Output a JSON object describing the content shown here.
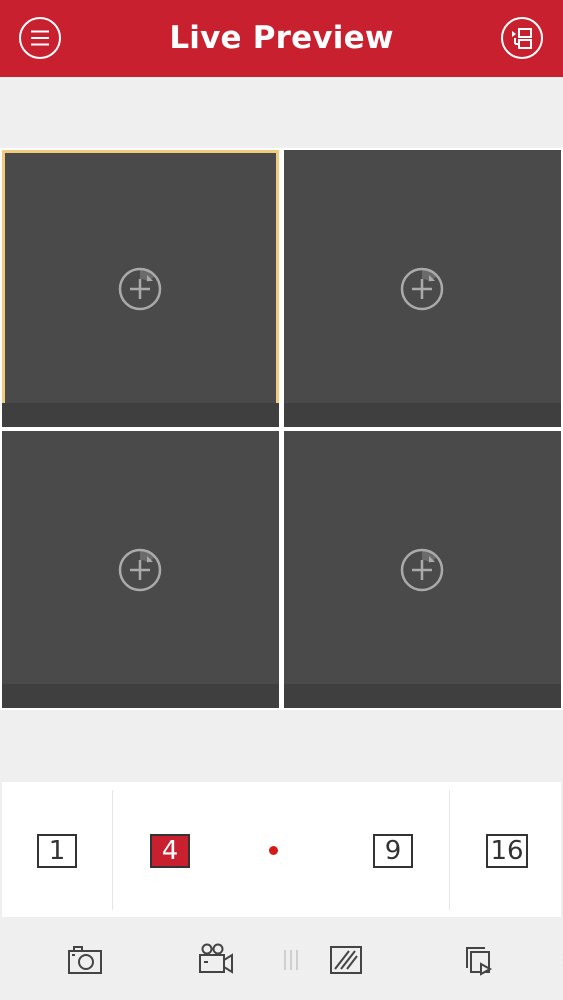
{
  "header": {
    "title": "Live Preview",
    "menu_icon": "menu-icon",
    "device_list_icon": "device-list-icon"
  },
  "colors": {
    "brand": "#c8202f",
    "selected_border": "#f2cc7e",
    "tile_bg": "#4a4a4a",
    "indicator_dot": "#d41b1b"
  },
  "tiles": [
    {
      "icon": "add-camera-icon",
      "selected": true
    },
    {
      "icon": "add-camera-icon",
      "selected": false
    },
    {
      "icon": "add-camera-icon",
      "selected": false
    },
    {
      "icon": "add-camera-icon",
      "selected": false
    }
  ],
  "layout_options": {
    "one": "1",
    "four": "4",
    "nine": "9",
    "sixteen": "16",
    "active": "4"
  },
  "toolbar": {
    "icons": [
      "camera-snapshot-icon",
      "video-record-icon",
      "drag-handle-icon",
      "image-quality-icon",
      "playback-icon",
      "chevron-right-icon"
    ]
  }
}
